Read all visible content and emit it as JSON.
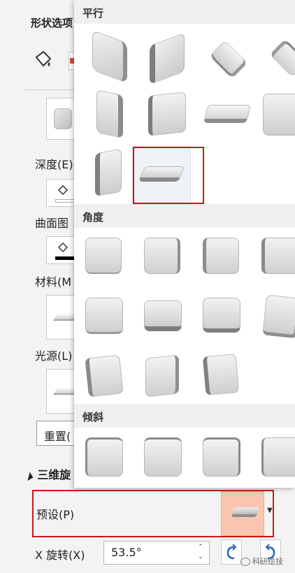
{
  "pane": {
    "title": "形状选项",
    "depth_label": "深度(E)",
    "contour_label": "曲面图",
    "material_label": "材料(M",
    "lighting_label": "光源(L)",
    "reset_label": "重置(",
    "rotation_section": "三维旋",
    "preset_label": "预设(P)",
    "x_rotation_label": "X 旋转(X)",
    "x_rotation_value": "53.5°",
    "spin_up": "⌃",
    "spin_down": "⌄",
    "preset_arrow": "▼"
  },
  "gallery": {
    "sections": [
      {
        "title": "平行",
        "items": [
          "Isometric Left Down",
          "Isometric Right Up",
          "Isometric Top Up",
          "Isometric Top Down",
          "Off Axis 1 Left",
          "Off Axis 1 Right",
          "Off Axis 1 Top",
          "Off Axis 2 Left",
          "Off Axis 2 Right",
          "Off Axis 2 Top"
        ]
      },
      {
        "title": "角度",
        "items": [
          "Perspective Left",
          "Perspective Right",
          "Perspective Below",
          "Perspective Above",
          "Perspective Left 2",
          "Perspective Below 2",
          "Perspective Above 2",
          "Perspective Right 2",
          "Perspective Heroic Left",
          "Perspective Heroic Right",
          "Perspective Relaxed"
        ]
      },
      {
        "title": "倾斜",
        "items": [
          "Oblique Top Left",
          "Oblique Top",
          "Oblique Top Right",
          "Oblique Left"
        ]
      }
    ],
    "selected_item": "Off Axis 2 Top"
  },
  "watermark": "科研绘技",
  "colors": {
    "highlight_red": "#c21b1b",
    "preset_fill": "#f9c7af",
    "contour_color": "#000000",
    "panel_bg": "#f3f3f3"
  }
}
